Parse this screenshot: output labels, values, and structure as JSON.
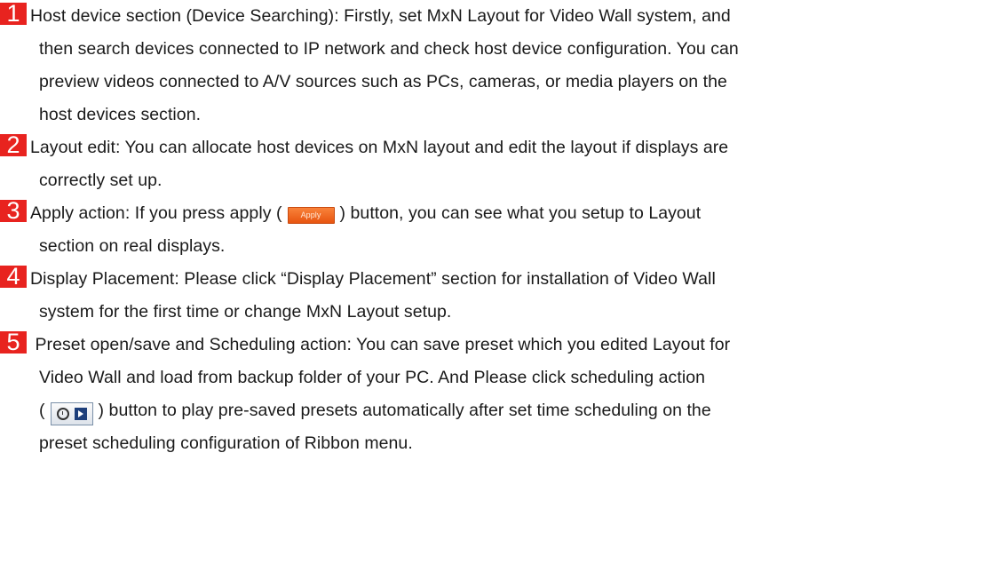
{
  "colors": {
    "badge": "#e8231f",
    "apply_button": "#f26a22",
    "text": "#1a1a1a"
  },
  "items": [
    {
      "number": "1",
      "lines": [
        "Host device section (Device Searching): Firstly, set MxN Layout for Video Wall system, and",
        "then search devices connected to IP network and check host device configuration. You can",
        "preview videos connected to A/V sources such as PCs, cameras, or media players on the",
        "host devices section."
      ]
    },
    {
      "number": "2",
      "lines": [
        "Layout edit: You can allocate host devices on MxN layout and edit the layout if displays are",
        "correctly set up."
      ]
    },
    {
      "number": "3",
      "line1_before": "Apply action: If you press apply (",
      "apply_label": "Apply",
      "line1_after": ") button, you can see what you setup to Layout",
      "lines": [
        "section on real displays."
      ]
    },
    {
      "number": "4",
      "lines": [
        "Display Placement: Please click “Display Placement” section for installation of Video Wall",
        "system for the first time or change MxN Layout setup."
      ]
    },
    {
      "number": "5",
      "lines": [
        " Preset open/save and Scheduling action: You can save preset which you edited Layout for",
        "Video Wall and load from backup folder of your PC. And Please click scheduling action"
      ],
      "line3_before": "(",
      "line3_after": ") button to play pre-saved presets automatically after set time scheduling on the",
      "lines_after": [
        "preset scheduling configuration of Ribbon menu."
      ],
      "icons": [
        "alarm-clock-icon",
        "play-icon"
      ]
    }
  ]
}
